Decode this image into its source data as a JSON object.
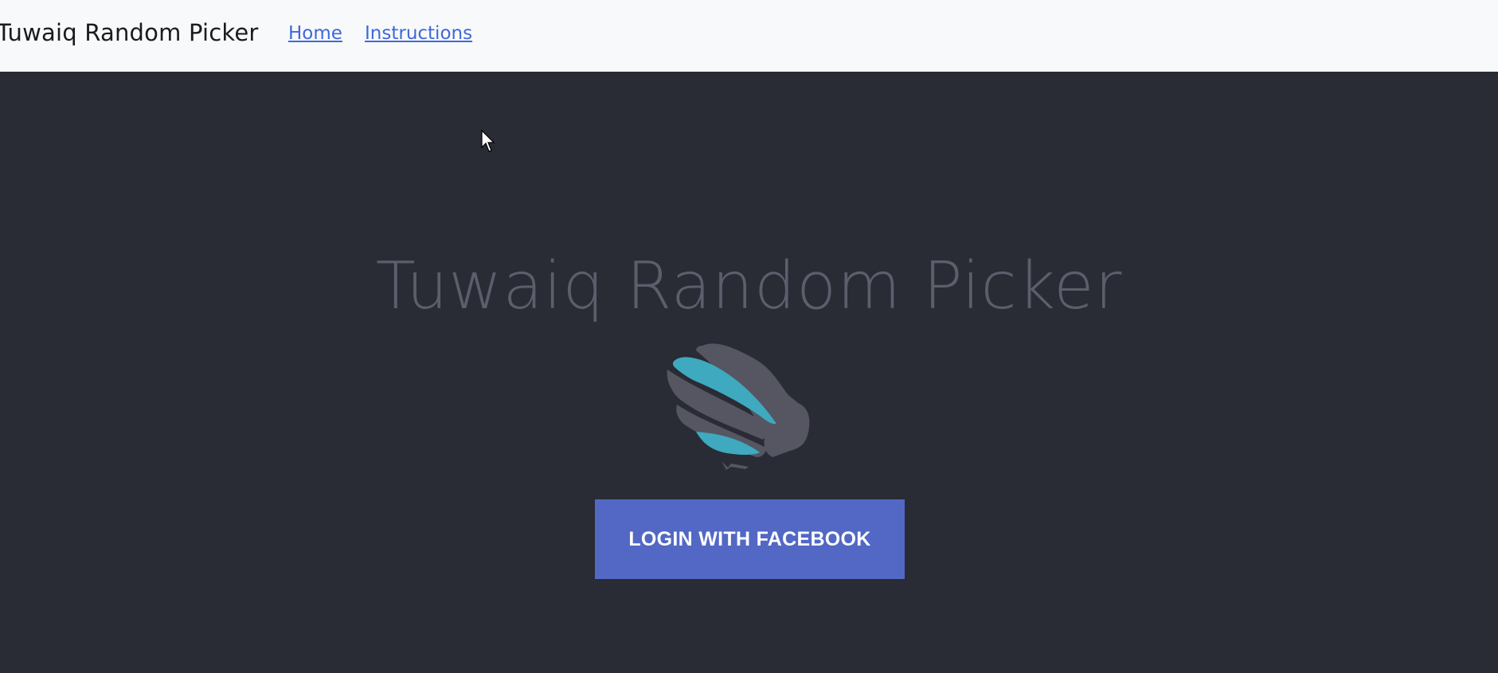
{
  "navbar": {
    "brand": "Tuwaiq Random Picker",
    "links": [
      {
        "label": "Home"
      },
      {
        "label": "Instructions"
      }
    ]
  },
  "hero": {
    "title": "Tuwaiq Random Picker",
    "logo_icon": "falcon-wing-logo",
    "login_button_label": "LOGIN WITH FACEBOOK"
  },
  "colors": {
    "navbar_bg": "#f8f9fb",
    "page_bg": "#292b35",
    "link": "#3f68d8",
    "title": "#5b5e6b",
    "button_bg": "#5268c4",
    "logo_teal": "#3ea9bf",
    "logo_gray": "#555662"
  }
}
